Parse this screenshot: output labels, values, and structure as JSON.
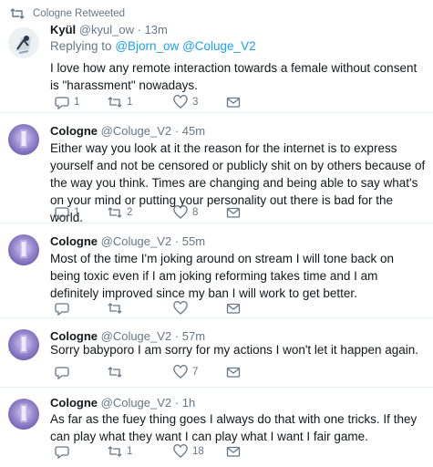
{
  "tweets": [
    {
      "retweet_label": "Cologne Retweeted",
      "name": "Kyül",
      "handle": "@kyul_ow",
      "dot": "·",
      "time": "13m",
      "reply_prefix": "Replying to",
      "reply_mention_1": "@Bjorn_ow",
      "reply_mention_2": "@Coluge_V2",
      "text": "I love how any remote interaction towards a female without consent is \"harassment\" nowadays.",
      "replies": "1",
      "retweets": "1",
      "likes": "3",
      "avatar_icon": "anime-avatar-icon"
    },
    {
      "name": "Cologne",
      "handle": "@Coluge_V2",
      "dot": "·",
      "time": "45m",
      "text": "Either way you look at it the reason for the internet is to express yourself and not be censored or publicly shit on by others because of the way you think. Times are changing and being able to say what's on your mind or putting your personality out there is bad for the world.",
      "replies": "1",
      "retweets": "2",
      "likes": "8",
      "avatar_icon": "purple-avatar-icon"
    },
    {
      "name": "Cologne",
      "handle": "@Coluge_V2",
      "dot": "·",
      "time": "55m",
      "text": "Most of the time I'm joking around on stream I will tone back on being toxic even if I am joking reforming takes time and I am definitely improved since my ban I will work to get better.",
      "replies": "",
      "retweets": "",
      "likes": "",
      "avatar_icon": "purple-avatar-icon"
    },
    {
      "name": "Cologne",
      "handle": "@Coluge_V2",
      "dot": "·",
      "time": "57m",
      "text": "Sorry babyporo I am sorry for my actions I won't let it happen again.",
      "replies": "",
      "retweets": "",
      "likes": "7",
      "avatar_icon": "purple-avatar-icon"
    },
    {
      "name": "Cologne",
      "handle": "@Coluge_V2",
      "dot": "·",
      "time": "1h",
      "text": "As far as the fuey thing goes I always do that with one tricks. If they can play what they want I can play what I want I fair game.",
      "replies": "",
      "retweets": "1",
      "likes": "18",
      "avatar_icon": "purple-avatar-icon"
    }
  ],
  "colors": {
    "text": "#14171a",
    "muted": "#657786",
    "link": "#1da1f2",
    "divider": "#e6ecf0"
  }
}
